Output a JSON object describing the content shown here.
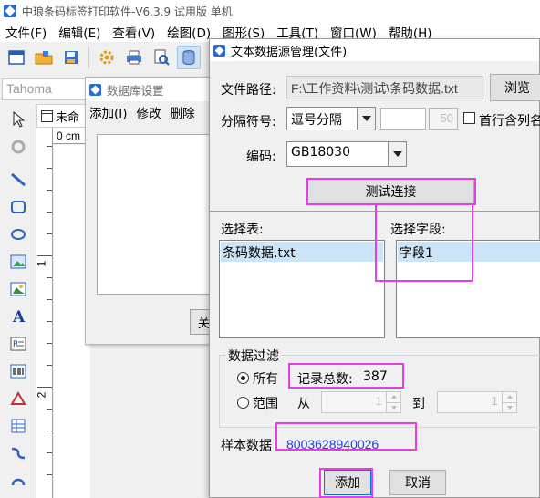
{
  "app": {
    "title": "中琅条码标签打印软件-V6.3.9 试用版 单机",
    "menus": [
      "文件(F)",
      "编辑(E)",
      "查看(V)",
      "绘图(D)",
      "图形(S)",
      "工具(T)",
      "窗口(W)",
      "帮助(H)"
    ],
    "font_name": "Tahoma",
    "document_tab": "未命",
    "ruler": {
      "h_label": "0 cm",
      "v_label_1": "1",
      "v_label_2": "2"
    }
  },
  "db_settings": {
    "title": "数据库设置",
    "menu": [
      "添加(I)",
      "修改",
      "删除"
    ],
    "partial_button": "关"
  },
  "dialog": {
    "title": "文本数据源管理(文件)",
    "file_path_label": "文件路径:",
    "file_path": "F:\\工作资料\\测试\\条码数据.txt",
    "browse": "浏览",
    "separator_label": "分隔符号:",
    "separator_value": "逗号分隔",
    "line_width": "50",
    "first_row_header": "首行含列名",
    "encoding_label": "编码:",
    "encoding_value": "GB18030",
    "test_connection": "测试连接",
    "select_table_label": "选择表:",
    "tables": [
      "条码数据.txt"
    ],
    "select_field_label": "选择字段:",
    "fields": [
      "字段1"
    ],
    "filter_title": "数据过滤",
    "filter_all": "所有",
    "record_total_label": "记录总数:",
    "record_total": "387",
    "filter_range": "范围",
    "from_label": "从",
    "from_value": "1",
    "to_label": "到",
    "to_value": "1",
    "sample_label": "样本数据",
    "sample_value": "8003628940026",
    "add_button": "添加",
    "cancel_button": "取消"
  },
  "colors": {
    "highlight": "#e63ee6",
    "selection": "#cce4f7",
    "sample_text": "#1f3fd8",
    "accent": "#2a6ad6"
  }
}
